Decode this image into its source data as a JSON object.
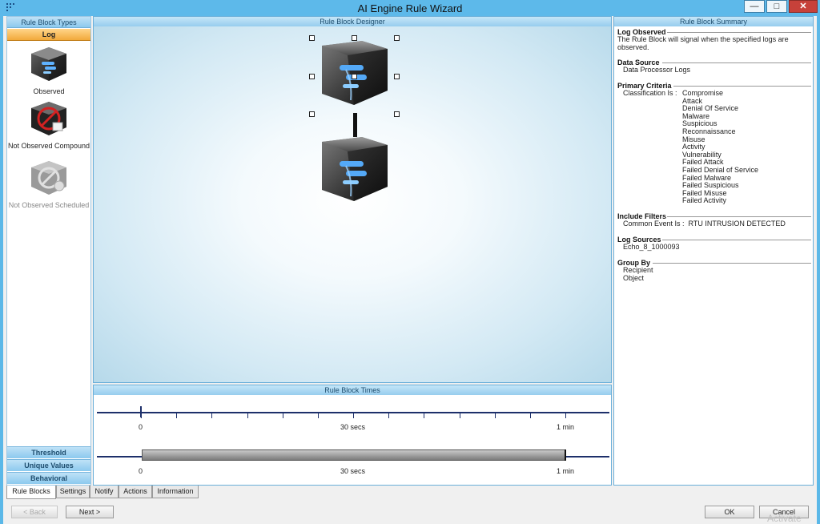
{
  "window": {
    "title": "AI Engine Rule Wizard",
    "minimize": "—",
    "maximize": "□",
    "close": "✕"
  },
  "left_pane": {
    "header": "Rule Block Types",
    "active_category": "Log",
    "items": [
      {
        "label": "Observed",
        "icon": "log-cube-icon"
      },
      {
        "label": "Not Observed Compound",
        "icon": "not-observed-icon"
      },
      {
        "label": "Not Observed Scheduled",
        "icon": "scheduled-icon"
      }
    ],
    "categories": [
      "Threshold",
      "Unique Values",
      "Behavioral"
    ]
  },
  "designer": {
    "header": "Rule Block Designer"
  },
  "times": {
    "header": "Rule Block Times",
    "labels": {
      "start": "0",
      "mid": "30 secs",
      "end": "1 min"
    },
    "range_fraction": 1.0
  },
  "summary": {
    "header": "Rule Block Summary",
    "log_observed": {
      "title": "Log Observed",
      "text": "The Rule Block will signal when the specified logs are observed."
    },
    "data_source": {
      "title": "Data Source",
      "value": "Data Processor Logs"
    },
    "primary_criteria": {
      "title": "Primary Criteria",
      "label": "Classification Is :",
      "values": [
        "Compromise",
        "Attack",
        "Denial Of Service",
        "Malware",
        "Suspicious",
        "Reconnaissance",
        "Misuse",
        "Activity",
        "Vulnerability",
        "Failed Attack",
        "Failed Denial of Service",
        "Failed Malware",
        "Failed Suspicious",
        "Failed Misuse",
        "Failed Activity"
      ]
    },
    "include_filters": {
      "title": "Include Filters",
      "label": "Common Event Is :",
      "value": "RTU INTRUSION DETECTED"
    },
    "log_sources": {
      "title": "Log Sources",
      "value": "Echo_8_1000093"
    },
    "group_by": {
      "title": "Group By",
      "values": [
        "Recipient",
        "Object"
      ]
    }
  },
  "tabs": [
    "Rule Blocks",
    "Settings",
    "Notify",
    "Actions",
    "Information"
  ],
  "buttons": {
    "back": "< Back",
    "next": "Next >",
    "ok": "OK",
    "cancel": "Cancel"
  },
  "watermark": "Activate"
}
